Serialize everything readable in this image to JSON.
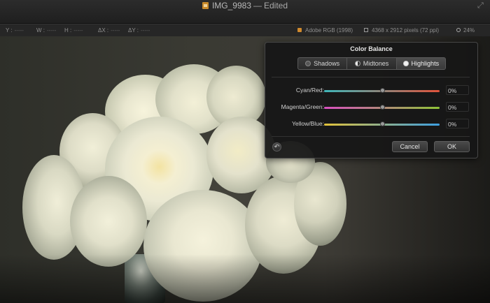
{
  "window": {
    "file_name": "IMG_9983",
    "separator": "—",
    "state": "Edited"
  },
  "infobar": {
    "y_label": "Y :",
    "w_label": "W :",
    "h_label": "H :",
    "dx_label": "ΔX :",
    "dy_label": "ΔY :",
    "placeholder": "-----",
    "color_profile": "Adobe RGB (1998)",
    "image_size": "4368 x 2912 pixels (72 ppi)",
    "zoom": "24%"
  },
  "dialog": {
    "title": "Color Balance",
    "tabs": [
      {
        "label": "Shadows",
        "active": false,
        "icon": "shadows-icon"
      },
      {
        "label": "Midtones",
        "active": false,
        "icon": "midtones-icon"
      },
      {
        "label": "Highlights",
        "active": true,
        "icon": "highlights-icon"
      }
    ],
    "sliders": [
      {
        "label": "Cyan/Red:",
        "value": "0%",
        "level": 0,
        "colors": [
          "#3fb6b9",
          "#e0533b"
        ]
      },
      {
        "label": "Magenta/Green:",
        "value": "0%",
        "level": 0,
        "colors": [
          "#d94fc0",
          "#8fc437"
        ]
      },
      {
        "label": "Yellow/Blue:",
        "value": "0%",
        "level": 0,
        "colors": [
          "#e2c23a",
          "#3d9fe0"
        ]
      }
    ],
    "revert_icon": "revert-icon",
    "cancel_label": "Cancel",
    "ok_label": "OK"
  }
}
